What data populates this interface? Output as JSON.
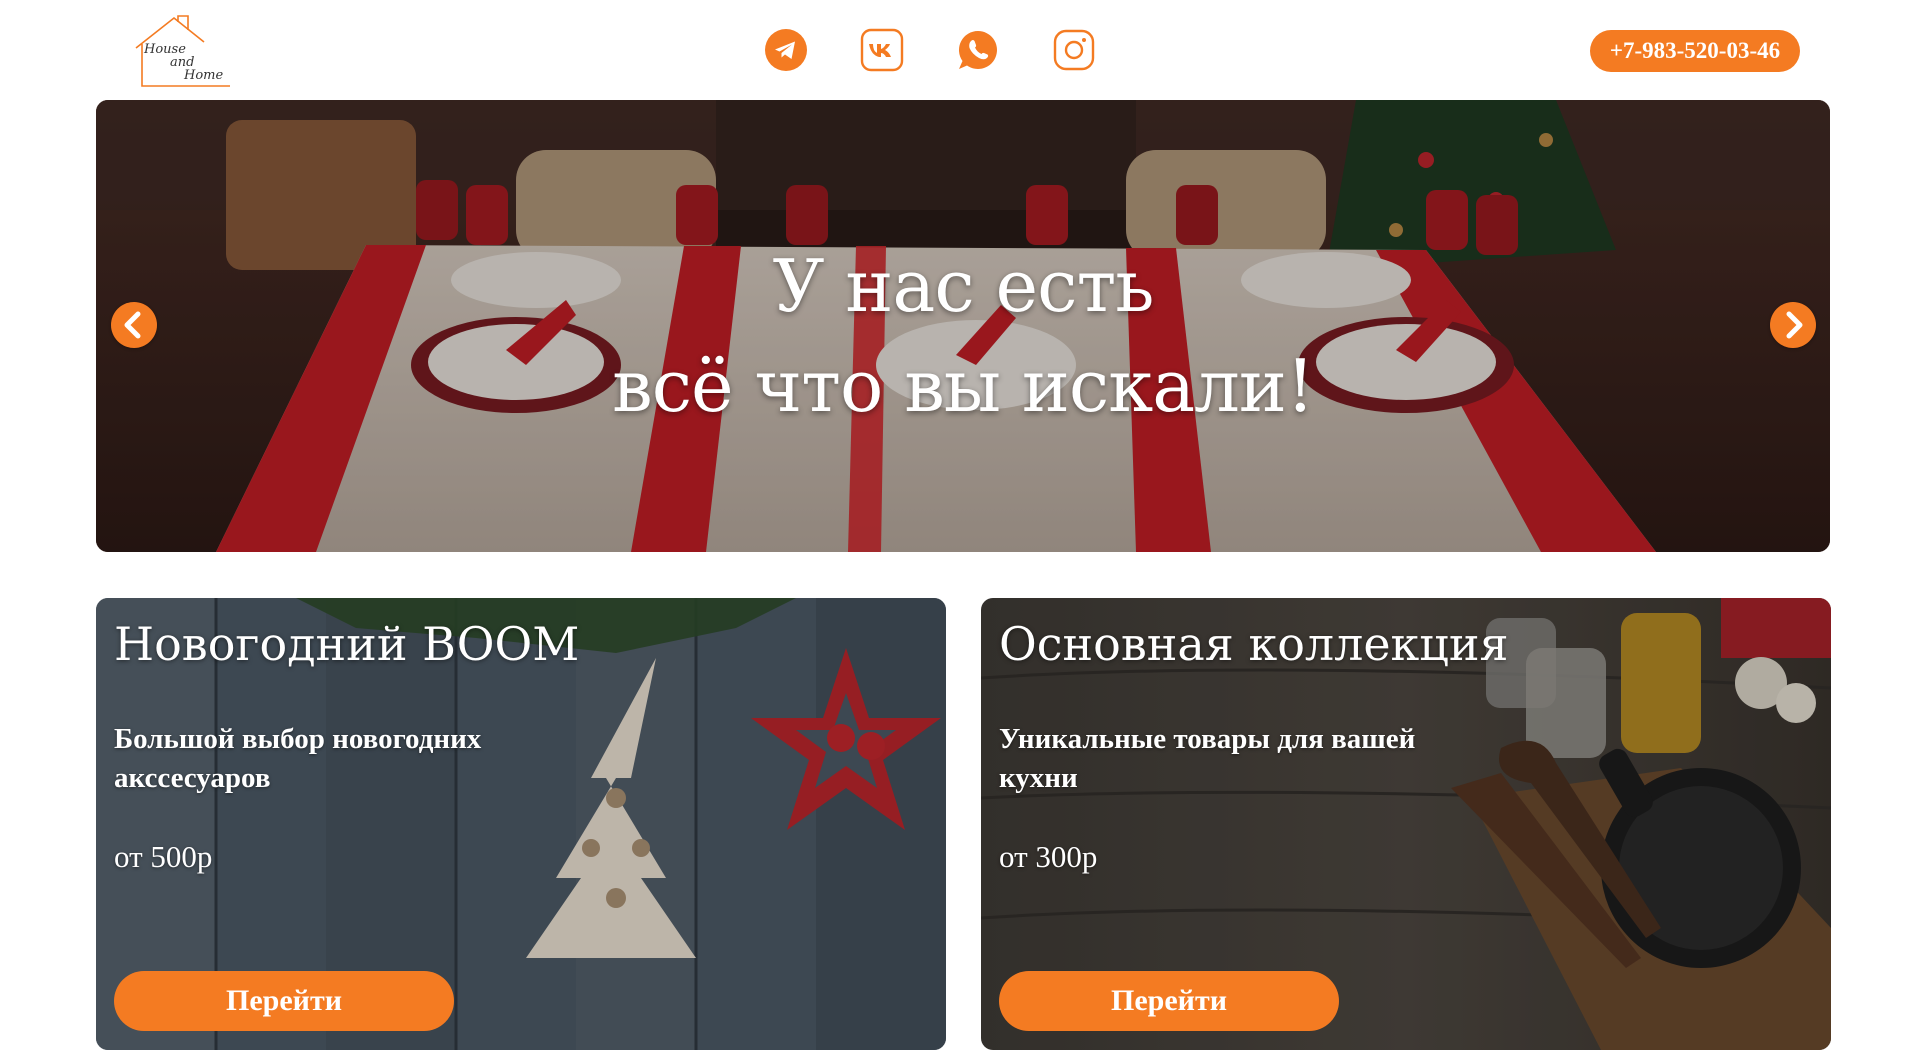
{
  "header": {
    "logo": {
      "line1": "House",
      "line2": "and",
      "line3": "Home"
    },
    "socials": [
      {
        "name": "telegram-icon"
      },
      {
        "name": "vk-icon"
      },
      {
        "name": "whatsapp-icon"
      },
      {
        "name": "instagram-icon"
      }
    ],
    "phone": "+7-983-520-03-46"
  },
  "hero": {
    "title_line1": "У нас есть",
    "title_line2": "всё что вы искали!",
    "prev_icon": "chevron-left-icon",
    "next_icon": "chevron-right-icon"
  },
  "cards": [
    {
      "title": "Новогодний BOOM",
      "description": "Большой выбор новогодних акссесуаров",
      "price": "от 500р",
      "button": "Перейти"
    },
    {
      "title": "Основная коллекция",
      "description": "Уникальные товары для вашей кухни",
      "price": "от 300р",
      "button": "Перейти"
    }
  ],
  "colors": {
    "accent": "#f47b22",
    "background": "#ffffff",
    "text_on_image": "#ffffff"
  }
}
